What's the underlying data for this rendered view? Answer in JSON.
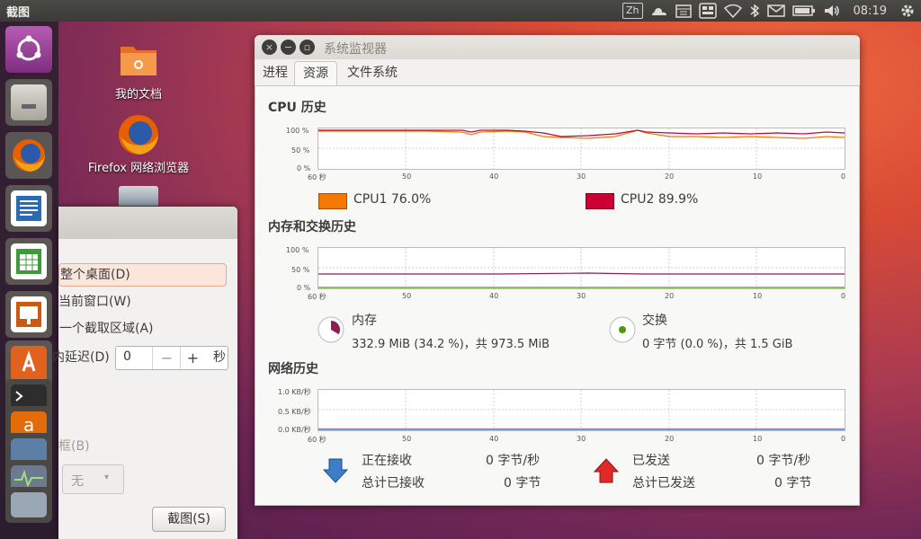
{
  "topbar": {
    "app_title": "截图",
    "input_method": "Zh",
    "clock": "08:19"
  },
  "desktop": {
    "icons": [
      {
        "label": "我的文档",
        "icon": "folder-icon"
      },
      {
        "label": "Firefox 网络浏览器",
        "icon": "firefox-icon"
      }
    ]
  },
  "screenshot_dialog": {
    "option_desktop": "整个桌面(D)",
    "option_window": "当前窗口(W)",
    "option_area": "一个截取区域(A)",
    "delay_label": "内延迟(D)",
    "delay_value": "0",
    "delay_unit": "秒",
    "border_label": "框(B)",
    "effect_value": "无",
    "take_button": "截图(S)"
  },
  "monitor": {
    "title": "系统监视器",
    "tabs": [
      "进程",
      "资源",
      "文件系统"
    ],
    "active_tab": "资源",
    "cpu": {
      "title": "CPU 历史",
      "y_ticks": [
        "100 %",
        "50 %",
        "0 %"
      ],
      "cpu1_label": "CPU1  76.0%",
      "cpu2_label": "CPU2  89.9%",
      "cpu1_color": "#f57900",
      "cpu2_color": "#cc0033"
    },
    "memory": {
      "title": "内存和交换历史",
      "y_ticks": [
        "100 %",
        "50 %",
        "0 %"
      ],
      "mem_label": "内存",
      "mem_value": "332.9 MiB (34.2 %)，共 973.5 MiB",
      "swap_label": "交换",
      "swap_value": "0 字节 (0.0 %)，共 1.5 GiB"
    },
    "network": {
      "title": "网络历史",
      "y_ticks": [
        "1.0 KB/秒",
        "0.5 KB/秒",
        "0.0 KB/秒"
      ],
      "recv_label": "正在接收",
      "recv_rate": "0 字节/秒",
      "recv_total_label": "总计已接收",
      "recv_total": "0 字节",
      "send_label": "已发送",
      "send_rate": "0 字节/秒",
      "send_total_label": "总计已发送",
      "send_total": "0 字节"
    },
    "x_ticks": [
      "60 秒",
      "50",
      "40",
      "30",
      "20",
      "10",
      "0"
    ]
  }
}
